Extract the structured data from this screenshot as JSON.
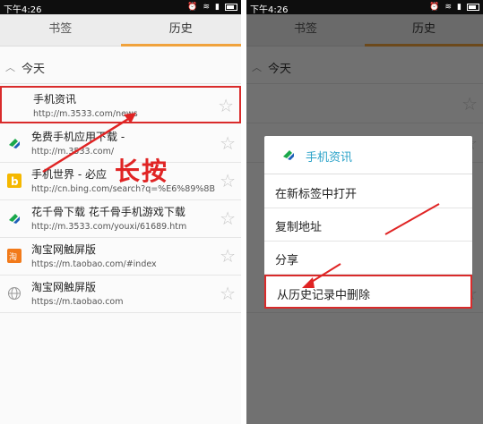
{
  "status": {
    "time": "下午4:26"
  },
  "tabs": {
    "bookmarks": "书签",
    "history": "历史"
  },
  "section": {
    "today": "今天"
  },
  "history": [
    {
      "title": "手机资讯",
      "url": "http://m.3533.com/news",
      "icon": "3533-logo-icon"
    },
    {
      "title": "免费手机应用下载 -",
      "url": "http://m.3533.com/",
      "icon": "3533-logo-icon"
    },
    {
      "title": "手机世界 - 必应",
      "url": "http://cn.bing.com/search?q=%E6%89%8B",
      "icon": "bing-logo-icon"
    },
    {
      "title": "花千骨下载 花千骨手机游戏下载",
      "url": "http://m.3533.com/youxi/61689.htm",
      "icon": "3533-logo-icon"
    },
    {
      "title": "淘宝网触屏版",
      "url": "https://m.taobao.com/#index",
      "icon": "taobao-logo-icon"
    },
    {
      "title": "淘宝网触屏版",
      "url": "https://m.taobao.com",
      "icon": "globe-icon"
    }
  ],
  "annotation": {
    "long_press": "长按"
  },
  "context_menu": {
    "title": "手机资讯",
    "items": [
      "在新标签中打开",
      "复制地址",
      "分享",
      "从历史记录中删除"
    ]
  },
  "colors": {
    "accent": "#f0a23c",
    "highlight": "#d92b2b",
    "menu_title": "#2aa2c8"
  }
}
